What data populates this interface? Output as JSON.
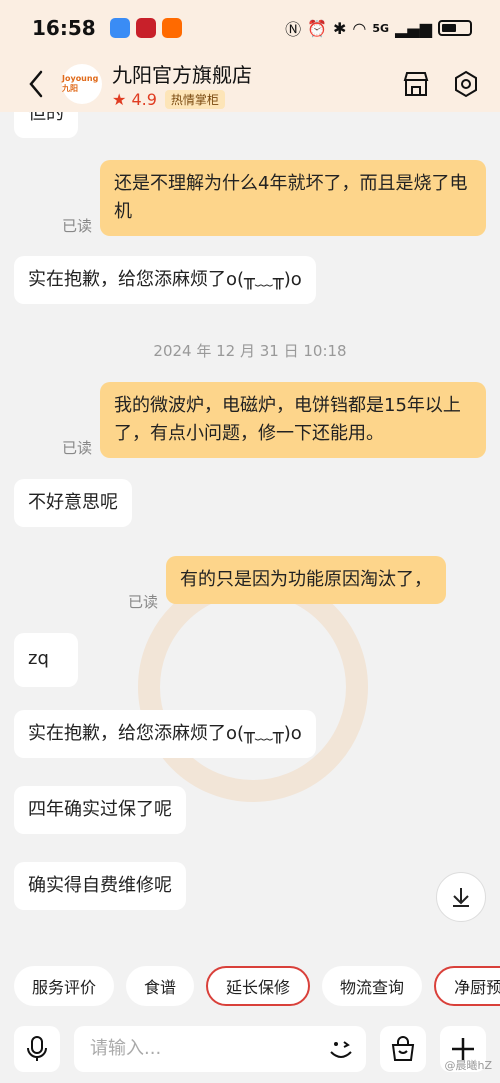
{
  "status_bar": {
    "time": "16:58",
    "network": "5G",
    "battery_level": 0.55
  },
  "header": {
    "shop_name": "九阳官方旗舰店",
    "logo_text": "Joyoung九阳",
    "rating": "4.9",
    "badge": "热情掌柜",
    "icons": [
      "back-arrow-icon",
      "store-icon",
      "settings-icon"
    ]
  },
  "messages": {
    "m0_partial": "但的",
    "m1": "还是不理解为什么4年就坏了，而且是烧了电机",
    "m1_read": "已读",
    "m2": "实在抱歉，给您添麻烦了o(╥﹏╥)o",
    "timestamp": "2024 年 12 月 31 日  10:18",
    "m3": "我的微波炉，电磁炉，电饼铛都是15年以上了，有点小问题，修一下还能用。",
    "m3_read": "已读",
    "m4": "不好意思呢",
    "m5": "有的只是因为功能原因淘汰了，",
    "m5_read": "已读",
    "m6": "zq",
    "m7": "实在抱歉，给您添麻烦了o(╥﹏╥)o",
    "m8": "四年确实过保了呢",
    "m9": "确实得自费维修呢"
  },
  "quick_replies": [
    "服务评价",
    "食谱",
    "延长保修",
    "物流查询",
    "净厨预约"
  ],
  "input": {
    "placeholder": "请输入..."
  },
  "watermark": "@晨曦hZ",
  "colors": {
    "header_bg": "#fbeee2",
    "seller_bubble": "#ffffff",
    "buyer_bubble": "#fdd58b",
    "accent_red": "#d9403a"
  }
}
